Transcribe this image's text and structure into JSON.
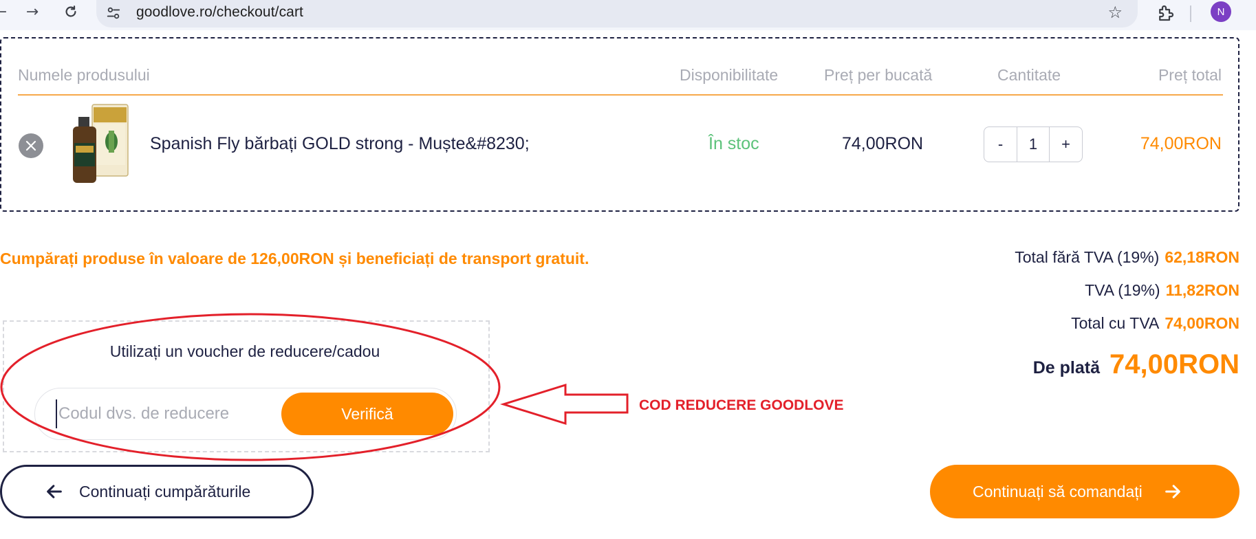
{
  "browser": {
    "url_host": "goodlove.ro",
    "url_path": "/checkout/cart",
    "profile_initial": "N",
    "icons": [
      "back-arrow-icon",
      "forward-arrow-icon",
      "reload-icon",
      "site-info-icon",
      "star-icon",
      "extensions-icon"
    ]
  },
  "cart": {
    "headers": {
      "product": "Numele produsului",
      "availability": "Disponibilitate",
      "unit_price": "Preț per bucată",
      "quantity": "Cantitate",
      "total": "Preț total"
    },
    "items": [
      {
        "name": "Spanish Fly bărbați GOLD strong - Muște&#8230;",
        "availability": "În stoc",
        "unit_price": "74,00RON",
        "quantity": "1",
        "total": "74,00RON"
      }
    ],
    "qty_minus": "-",
    "qty_plus": "+"
  },
  "promo": {
    "prefix": "Cumpărați produse în valoare de ",
    "amount": "126,00RON",
    "suffix": " și beneficiați de transport gratuit."
  },
  "totals": {
    "net_label": "Total fără TVA (19%)",
    "net_value": "62,18RON",
    "vat_label": "TVA (19%)",
    "vat_value": "11,82RON",
    "gross_label": "Total cu TVA",
    "gross_value": "74,00RON",
    "due_label": "De plată",
    "due_value": "74,00RON"
  },
  "voucher": {
    "title": "Utilizați un voucher de reducere/cadou",
    "placeholder": "Codul dvs. de reducere",
    "button": "Verifică"
  },
  "annotation": {
    "label": "COD REDUCERE GOODLOVE"
  },
  "actions": {
    "continue_shopping": "Continuați cumpărăturile",
    "continue_order": "Continuați să comandați"
  },
  "colors": {
    "accent": "#ff8a00",
    "navy": "#1e2142",
    "in_stock": "#5cc27a",
    "annotation_red": "#e3202a"
  }
}
